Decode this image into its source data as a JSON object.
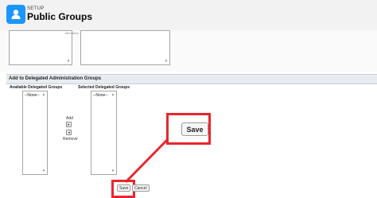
{
  "header": {
    "eyebrow": "SETUP",
    "title": "Public Groups",
    "icon": "user-icon"
  },
  "top_lists": {
    "right_label": "Members"
  },
  "delegated": {
    "section_title": "Add to Delegated Administration Groups",
    "available_label": "Available Delegated Groups",
    "selected_label": "Selected Delegated Groups",
    "available_options": [
      "--None--"
    ],
    "selected_options": [
      "--None--"
    ],
    "add_label": "Add",
    "remove_label": "Remove"
  },
  "callout": {
    "save_label": "Save"
  },
  "footer": {
    "save_label": "Save",
    "cancel_label": "Cancel"
  },
  "colors": {
    "highlight": "#e8262e",
    "header_icon": "#1b96ff"
  }
}
